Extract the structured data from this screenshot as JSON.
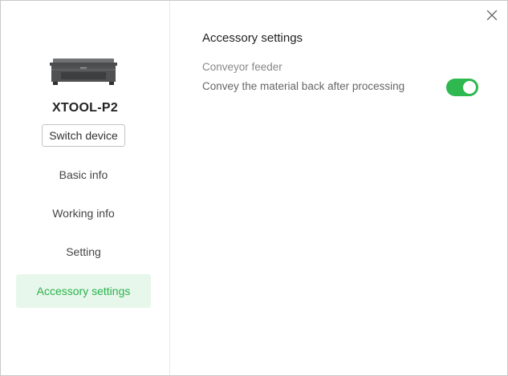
{
  "sidebar": {
    "device_name": "XTOOL-P2",
    "switch_device_label": "Switch device",
    "items": [
      {
        "label": "Basic info"
      },
      {
        "label": "Working info"
      },
      {
        "label": "Setting"
      },
      {
        "label": "Accessory settings",
        "active": true
      }
    ]
  },
  "main": {
    "title": "Accessory settings",
    "section": "Conveyor feeder",
    "option_label": "Convey the material back after processing",
    "option_enabled": true
  },
  "colors": {
    "accent": "#2eb84f",
    "active_bg": "#e8f7ec"
  },
  "icons": {
    "close": "close-icon",
    "device": "laser-engraver-image"
  }
}
